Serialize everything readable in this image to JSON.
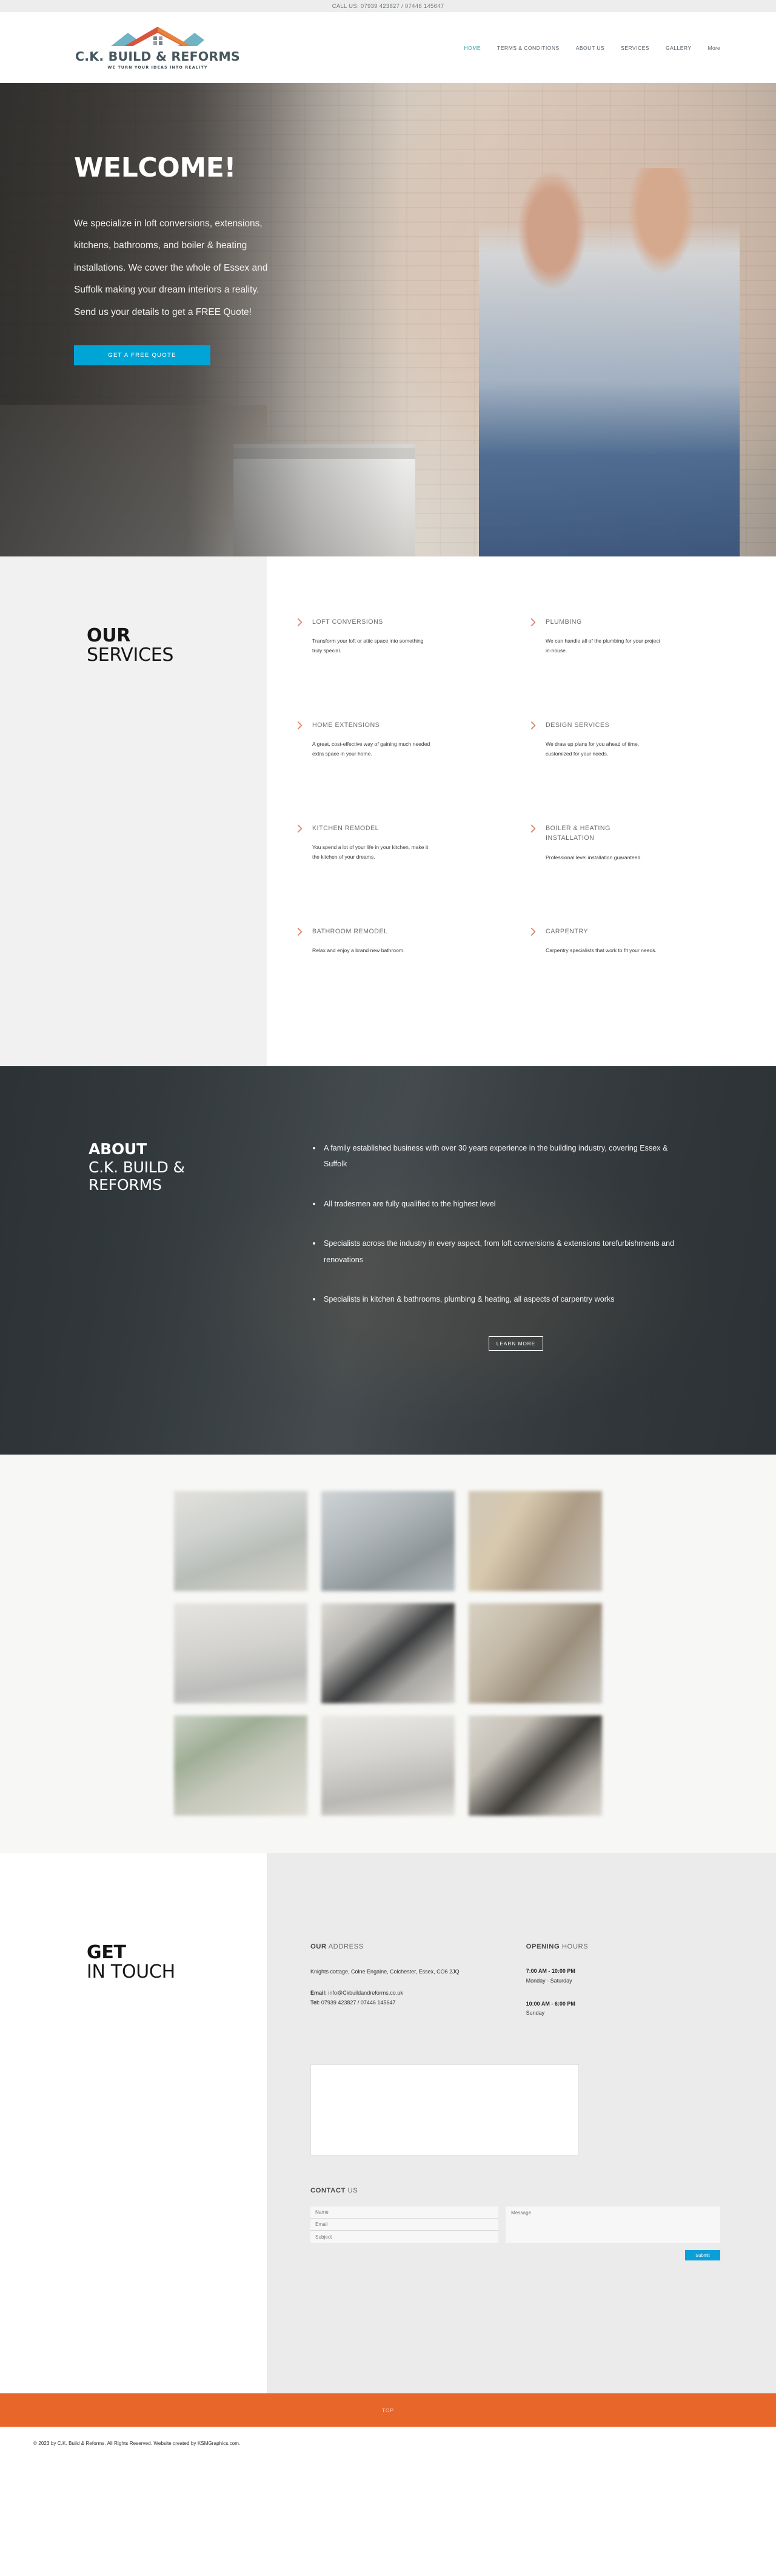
{
  "topbar": {
    "phone_text": "CALL US: 07939 423827 / 07446 145647"
  },
  "header": {
    "logo_name": "C.K. BUILD & REFORMS",
    "logo_tagline": "WE TURN YOUR IDEAS INTO REALITY",
    "nav": [
      {
        "label": "HOME",
        "active": true
      },
      {
        "label": "TERMS & CONDITIONS",
        "active": false
      },
      {
        "label": "ABOUT US",
        "active": false
      },
      {
        "label": "SERVICES",
        "active": false
      },
      {
        "label": "GALLERY",
        "active": false
      },
      {
        "label": "More",
        "active": false
      }
    ]
  },
  "hero": {
    "title": "WELCOME!",
    "body": "We specialize in loft conversions, extensions, kitchens, bathrooms, and boiler & heating installations. We cover the whole of Essex and Suffolk making your dream interiors a reality. Send us your details to get a FREE Quote!",
    "cta_label": "GET A FREE QUOTE",
    "cta_color": "#00a5d6"
  },
  "services": {
    "heading_bold": "OUR",
    "heading_light": "SERVICES",
    "chevron_color": "#e08a72",
    "items": [
      {
        "title": "LOFT CONVERSIONS",
        "desc": "Transform your loft or attic space into something truly special."
      },
      {
        "title": "PLUMBING",
        "desc": "We can handle all of the plumbing for your project in-house."
      },
      {
        "title": "HOME EXTENSIONS",
        "desc": "A great, cost-effective way of gaining much needed extra space in your home."
      },
      {
        "title": "DESIGN SERVICES",
        "desc": "We draw up plans for you ahead of time, customized for your needs."
      },
      {
        "title": "KITCHEN REMODEL",
        "desc": "You spend a lot of your life in your kitchen, make it the kitchen of your dreams."
      },
      {
        "title": "BOILER & HEATING INSTALLATION",
        "desc": "Professional level installation guaranteed."
      },
      {
        "title": "BATHROOM REMODEL",
        "desc": "Relax and enjoy a brand new bathroom."
      },
      {
        "title": "CARPENTRY",
        "desc": "Carpentry specialists that work to fit your needs."
      }
    ]
  },
  "about": {
    "heading_bold": "ABOUT",
    "heading_light_1": "C.K. BUILD &",
    "heading_light_2": "REFORMS",
    "bullets": [
      "A family established business with over 30 years experience in the building industry, covering Essex & Suffolk",
      "All tradesmen are fully qualified to the highest level",
      "Specialists across the industry in every aspect, from loft conversions & extensions torefurbishments and renovations",
      "Specialists in kitchen & bathrooms, plumbing & heating, all aspects of carpentry works"
    ],
    "cta_label": "LEARN MORE"
  },
  "gallery": {
    "tiles": [
      "g1",
      "g2",
      "g3",
      "g4",
      "g5",
      "g6",
      "g7",
      "g8",
      "g9"
    ]
  },
  "contact": {
    "heading_bold": "GET",
    "heading_light": "IN TOUCH",
    "address": {
      "head_bold": "OUR",
      "head_light": " ADDRESS",
      "lines": "Knights cottage, Colne Engaine, Colchester, Essex, CO6 2JQ",
      "email_label": "Email:",
      "email_value": " info@Ckbuildandreforms.co.uk",
      "tel_label": "Tel:",
      "tel_value": " 07939 423827 / 07446 145647"
    },
    "hours": {
      "head_bold": "OPENING",
      "head_light": " HOURS",
      "rows": [
        {
          "time": "7:00 AM - 10:00 PM",
          "days": "Monday - Saturday"
        },
        {
          "time": "10:00 AM - 6:00 PM",
          "days": "Sunday"
        }
      ]
    },
    "form": {
      "head_bold": "CONTACT",
      "head_light": " US",
      "name_placeholder": "Name",
      "email_placeholder": "Email",
      "subject_placeholder": "Subject",
      "message_placeholder": "Message",
      "submit_label": "Submit",
      "submit_color": "#0b9fd8"
    }
  },
  "footer": {
    "top_label": "TOP",
    "top_color": "#e8662a",
    "copyright": "© 2023 by C.K. Build & Reforms. All Rights Reserved. Website created by KSMGraphics.com."
  }
}
